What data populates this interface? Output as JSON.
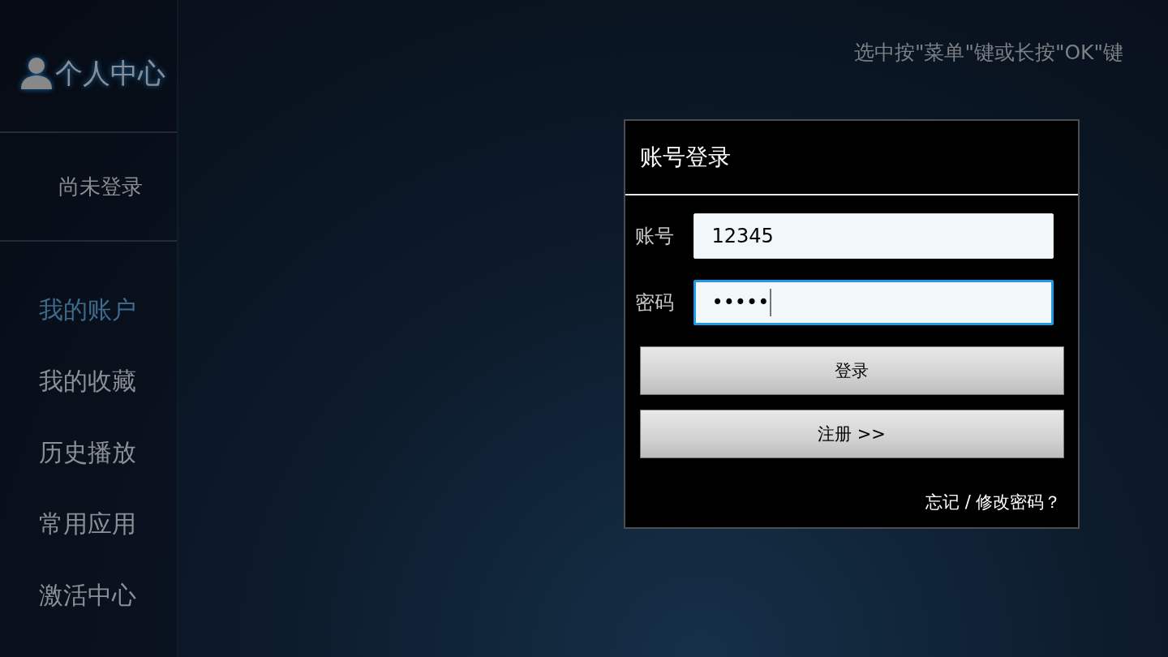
{
  "sidebar": {
    "title": "个人中心",
    "status": "尚未登录",
    "items": [
      {
        "label": "我的账户",
        "selected": true
      },
      {
        "label": "我的收藏",
        "selected": false
      },
      {
        "label": "历史播放",
        "selected": false
      },
      {
        "label": "常用应用",
        "selected": false
      },
      {
        "label": "激活中心",
        "selected": false
      }
    ]
  },
  "hint": "选中按\"菜单\"键或长按\"OK\"键",
  "dialog": {
    "title": "账号登录",
    "fields": [
      {
        "label": "账号",
        "value": "12345",
        "focused": false
      },
      {
        "label": "密码",
        "value": "•••••",
        "focused": true
      }
    ],
    "buttons": [
      "登录",
      "注册 >>"
    ],
    "link": "忘记 / 修改密码？"
  }
}
